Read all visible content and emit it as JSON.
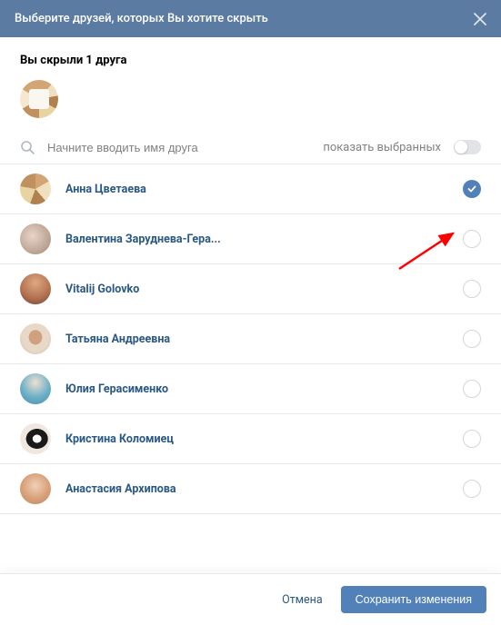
{
  "header": {
    "title": "Выберите друзей, которых Вы хотите скрыть"
  },
  "hidden_section": {
    "title": "Вы скрыли 1 друга"
  },
  "search": {
    "placeholder": "Начните вводить имя друга",
    "show_selected_label": "показать выбранных"
  },
  "friends": [
    {
      "name": "Анна Цветаева",
      "selected": true
    },
    {
      "name": "Валентина Заруднева-Гера...",
      "selected": false
    },
    {
      "name": "Vitalij Golovko",
      "selected": false
    },
    {
      "name": "Татьяна Андреевна",
      "selected": false
    },
    {
      "name": "Юлия Герасименко",
      "selected": false
    },
    {
      "name": "Кристина Коломиец",
      "selected": false
    },
    {
      "name": "Анастасия Архипова",
      "selected": false
    }
  ],
  "footer": {
    "cancel": "Отмена",
    "save": "Сохранить изменения"
  },
  "colors": {
    "header_bg": "#5b7ba3",
    "link": "#2a5885",
    "primary": "#5181b8",
    "arrow": "#ff0000"
  }
}
